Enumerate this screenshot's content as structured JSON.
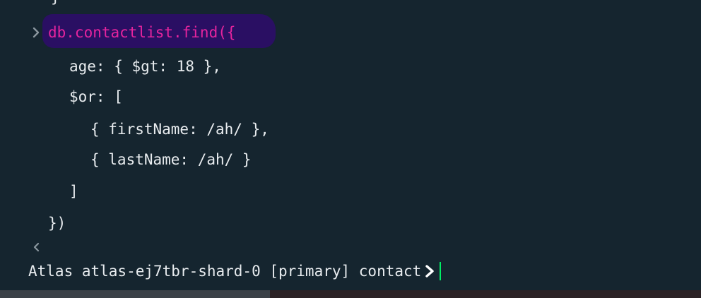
{
  "shell": {
    "previous_brace": "}",
    "command": {
      "line1": "db.contactlist.find({",
      "line2": "age: { $gt: 18 },",
      "line3": "$or: [",
      "line4": "{ firstName: /ah/ },",
      "line5": "{ lastName: /ah/ }",
      "line6": "]",
      "line7": "})"
    },
    "prompt": "Atlas atlas-ej7tbr-shard-0 [primary] contact",
    "icons": {
      "input_marker": "chevron-right-icon",
      "output_marker": "chevron-left-icon",
      "prompt_marker": "chevron-right-icon"
    }
  },
  "colors": {
    "background": "#15252f",
    "text": "#e8ecef",
    "command_highlight_bg": "#2a0f63",
    "command_highlight_text": "#e6249e",
    "cursor": "#00ed64",
    "marker": "#8a969e"
  }
}
